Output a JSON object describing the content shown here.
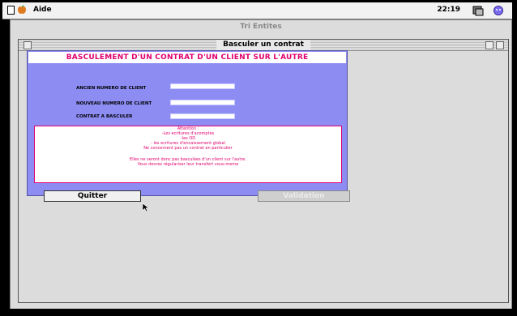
{
  "menubar": {
    "menu_label": "Aide",
    "clock": "22:19",
    "icons": [
      "document-icon",
      "apple-icon",
      "app-switcher-icon",
      "help-icon"
    ]
  },
  "background_window": {
    "title": "Tri Entites"
  },
  "window": {
    "title": "Basculer un contrat"
  },
  "form": {
    "heading": "BASCULEMENT  D'UN CONTRAT D'UN CLIENT SUR L'AUTRE",
    "fields": [
      {
        "label": "ANCIEN NUMERO DE CLIENT",
        "value": ""
      },
      {
        "label": "NOUVEAU NUMERO DE CLIENT",
        "value": ""
      },
      {
        "label": "CONTRAT A BASCULER",
        "value": ""
      }
    ],
    "notice": {
      "lines": [
        "Attention :",
        "-Les ecritures d'acomptes",
        "-les OD",
        "- les ecritures d'encaissement global",
        "Ne concernent pas un contrat en particulier"
      ],
      "footer_lines": [
        "Elles ne seront donc pas basculées d'un client sur l'autre.",
        "Vous devrez régulariser leur transfert vous-meme"
      ]
    },
    "quit_button": "Quitter",
    "validate_button": "Validation"
  },
  "colors": {
    "panel": "#8c8cf3",
    "accent": "#e0006e",
    "window_bg": "#dcdcdc"
  }
}
